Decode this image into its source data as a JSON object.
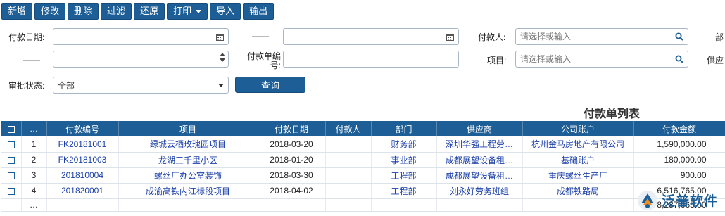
{
  "toolbar": {
    "add": "新增",
    "edit": "修改",
    "delete": "删除",
    "filter": "过滤",
    "restore": "还原",
    "print": "打印",
    "import": "导入",
    "export": "输出"
  },
  "form": {
    "pay_date_label": "付款日期:",
    "dash": "——",
    "payer_label": "付款人:",
    "payer_placeholder": "请选择或输入",
    "dept_label_partial": "部",
    "pay_no_label": "付款单编号:",
    "project_label": "项目:",
    "project_placeholder": "请选择或输入",
    "supplier_label_partial": "供应",
    "approval_label": "审批状态:",
    "approval_value": "全部",
    "query_button": "查询"
  },
  "list_title": "付款单列表",
  "table": {
    "headers": [
      "…",
      "付款编号",
      "项目",
      "付款日期",
      "付款人",
      "部门",
      "供应商",
      "公司账户",
      "付款金额"
    ],
    "rows": [
      {
        "idx": "1",
        "no": "FK20181001",
        "project": "绿城云栖玫瑰园项目",
        "date": "2018-03-20",
        "payer": "",
        "dept": "财务部",
        "supplier": "深圳华强工程劳…",
        "account": "杭州金马房地产有限公司",
        "amount": "1,590,000.00"
      },
      {
        "idx": "2",
        "no": "FK20181003",
        "project": "龙湖三千里小区",
        "date": "2018-01-20",
        "payer": "",
        "dept": "事业部",
        "supplier": "成都展望设备租…",
        "account": "基础账户",
        "amount": "180,000.00"
      },
      {
        "idx": "3",
        "no": "201810004",
        "project": "螺丝厂办公室装饰",
        "date": "2018-03-30",
        "payer": "",
        "dept": "工程部",
        "supplier": "成都展望设备租…",
        "account": "重庆螺丝生产厂",
        "amount": "900.00"
      },
      {
        "idx": "4",
        "no": "201820001",
        "project": "成渝高铁内江标段项目",
        "date": "2018-04-02",
        "payer": "",
        "dept": "工程部",
        "supplier": "刘永好劳务班组",
        "account": "成都铁路局",
        "amount": "6,516,765.00"
      }
    ],
    "footer_ellipsis": "…",
    "total": "8,287,665.00"
  },
  "logo": {
    "text": "泛普软件"
  },
  "colors": {
    "primary": "#1d5e96",
    "link": "#1a3fa8"
  }
}
